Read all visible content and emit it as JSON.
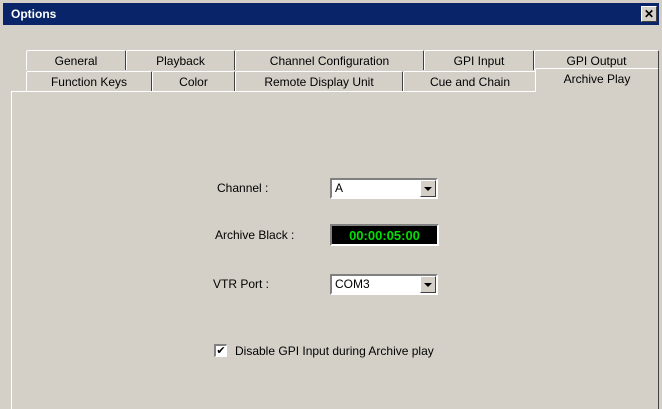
{
  "window": {
    "title": "Options",
    "close_label": "✕"
  },
  "tabs": {
    "row1": [
      "General",
      "Playback",
      "Channel Configuration",
      "GPI Input",
      "GPI Output"
    ],
    "row2": [
      "Function Keys",
      "Color",
      "Remote Display Unit",
      "Cue and Chain",
      "Archive Play"
    ],
    "active": "Archive Play"
  },
  "form": {
    "channel_label": "Channel :",
    "channel_value": "A",
    "archive_black_label": "Archive Black :",
    "archive_black_value": "00:00:05:00",
    "vtr_port_label": "VTR Port :",
    "vtr_port_value": "COM3",
    "disable_gpi_label": "Disable GPI Input during Archive play",
    "disable_gpi_checked": true,
    "check_mark": "✔"
  },
  "colors": {
    "title_bar": "#0a246a",
    "timecode_text": "#00e000",
    "timecode_bg": "#000000"
  }
}
